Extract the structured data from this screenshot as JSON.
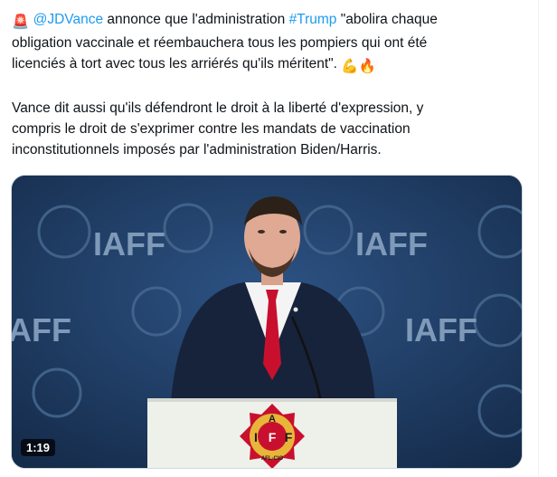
{
  "tweet": {
    "siren_emoji": "🚨",
    "mention": "@JDVance",
    "text_1a": " annonce que l'administration ",
    "hashtag": "#Trump",
    "text_1b": " \"abolira chaque",
    "text_2": "obligation vaccinale et réembauchera tous les pompiers qui ont été",
    "text_3": "licenciés à tort avec tous les arriérés qu'ils méritent\".",
    "emojis_end": "💪🔥",
    "para2_line1": "Vance dit aussi qu'ils défendront le droit à la liberté d'expression, y",
    "para2_line2": "compris le droit de s'exprimer contre les mandats de vaccination",
    "para2_line3": "inconstitutionnels imposés par l'administration Biden/Harris."
  },
  "video": {
    "duration": "1:19",
    "backdrop_logo": "IAFF",
    "podium_letters": {
      "top": "A",
      "left": "I",
      "center": "F",
      "right": "F",
      "bottom": "AFL-CIO"
    }
  },
  "colors": {
    "link": "#1d9bf0",
    "stage_bg": "#1f3b63",
    "tie": "#c8102e",
    "podium": "#eef0ea",
    "emblem_gold": "#e8b53a",
    "emblem_red": "#c8102e"
  }
}
